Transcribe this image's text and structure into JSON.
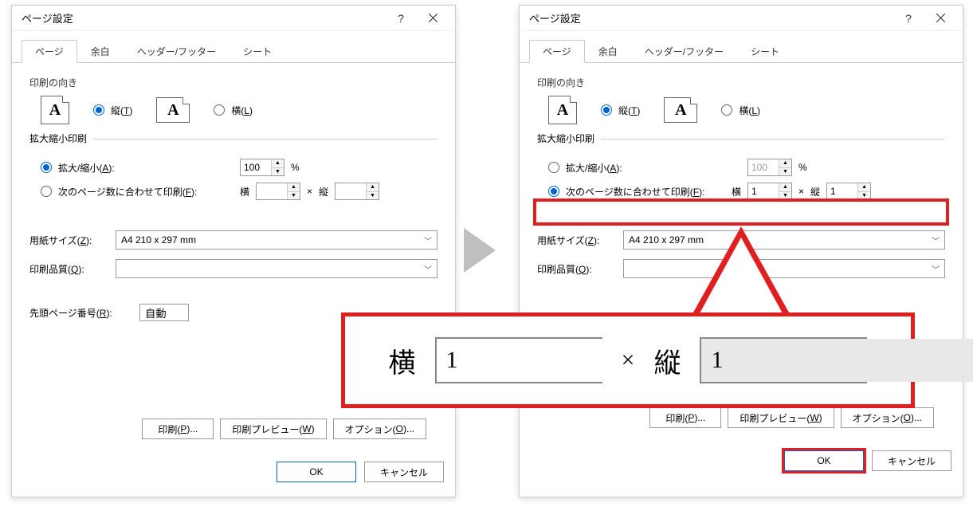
{
  "dialog": {
    "title": "ページ設定",
    "help": "?",
    "tabs": {
      "page": "ページ",
      "margins": "余白",
      "headerfooter": "ヘッダー/フッター",
      "sheet": "シート"
    },
    "orientation": {
      "label": "印刷の向き",
      "portrait_pre": "縦(",
      "portrait_key": "T",
      "portrait_post": ")",
      "landscape_pre": "横(",
      "landscape_key": "L",
      "landscape_post": ")"
    },
    "scaling": {
      "label": "拡大縮小印刷",
      "adjust_pre": "拡大/縮小(",
      "adjust_key": "A",
      "adjust_post": "):",
      "adjust_value": "100",
      "adjust_unit": "%",
      "fit_pre": "次のページ数に合わせて印刷(",
      "fit_key": "F",
      "fit_post": "):",
      "fit_wide_label": "横",
      "fit_tall_label": "縦",
      "fit_x": "×",
      "fit_wide_val": "1",
      "fit_tall_val": "1",
      "fit_tall_val_cursor": "1|"
    },
    "paper": {
      "size_pre": "用紙サイズ(",
      "size_key": "Z",
      "size_post": "):",
      "size_value": "A4 210 x 297 mm",
      "quality_pre": "印刷品質(",
      "quality_key": "Q",
      "quality_post": "):",
      "quality_value": ""
    },
    "firstpage": {
      "label_pre": "先頭ページ番号(",
      "label_key": "R",
      "label_post": "):",
      "value": "自動"
    },
    "buttons": {
      "print_pre": "印刷(",
      "print_key": "P",
      "print_post": ")...",
      "preview_pre": "印刷プレビュー(",
      "preview_key": "W",
      "preview_post": ")",
      "options_pre": "オプション(",
      "options_key": "O",
      "options_post": ")...",
      "ok": "OK",
      "cancel": "キャンセル"
    }
  },
  "left_state": {
    "orient": "portrait",
    "scaling_mode": "adjust"
  },
  "right_state": {
    "orient": "portrait",
    "scaling_mode": "fit"
  },
  "zoom": {
    "wide_label": "横",
    "wide_val": "1",
    "x": "×",
    "tall_label": "縦",
    "tall_val": "1"
  },
  "icons": {
    "letter": "A"
  }
}
